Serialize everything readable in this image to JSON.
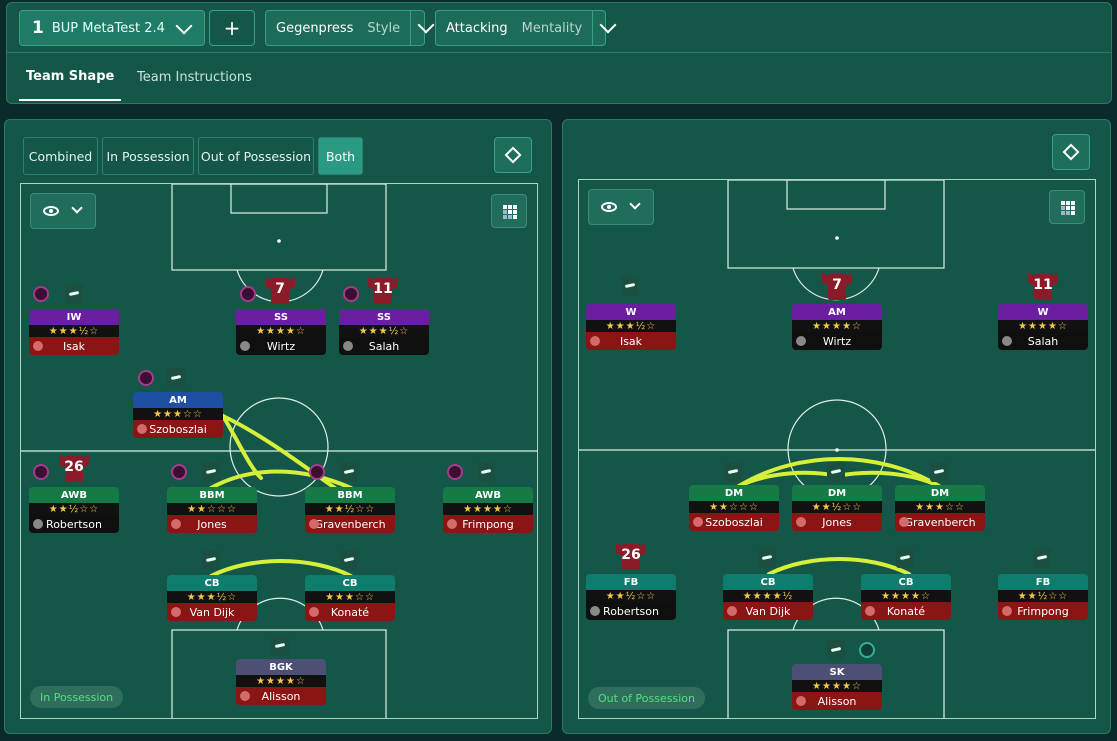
{
  "header": {
    "tactic_number": "1",
    "tactic_name": "BUP MetaTest 2.4",
    "add_label": "+",
    "style_value": "Gegenpress",
    "style_key": "Style",
    "mentality_value": "Attacking",
    "mentality_key": "Mentality"
  },
  "tabs": [
    {
      "label": "Team Shape",
      "active": true
    },
    {
      "label": "Team Instructions",
      "active": false
    }
  ],
  "view_modes": [
    {
      "label": "Combined",
      "selected": false
    },
    {
      "label": "In Possession",
      "selected": false
    },
    {
      "label": "Out of Possession",
      "selected": false
    },
    {
      "label": "Both",
      "selected": true
    }
  ],
  "in_possession": {
    "phase_label": "In Possession",
    "players": [
      {
        "role": "IW",
        "color": "purple",
        "stars": "★★★½☆",
        "name": "Isak",
        "name_style": "bad",
        "shirt": ""
      },
      {
        "role": "SS",
        "color": "purple",
        "stars": "★★★★☆",
        "name": "Wirtz",
        "name_style": "good",
        "shirt": "7"
      },
      {
        "role": "SS",
        "color": "purple",
        "stars": "★★★½☆",
        "name": "Salah",
        "name_style": "good",
        "shirt": "11"
      },
      {
        "role": "AM",
        "color": "blue",
        "stars": "★★★☆☆",
        "name": "Szoboszlai",
        "name_style": "bad",
        "shirt": ""
      },
      {
        "role": "AWB",
        "color": "green",
        "stars": "★★½☆☆",
        "name": "Robertson",
        "name_style": "good",
        "shirt": "26"
      },
      {
        "role": "BBM",
        "color": "green",
        "stars": "★★☆☆☆",
        "name": "Jones",
        "name_style": "bad",
        "shirt": ""
      },
      {
        "role": "BBM",
        "color": "green",
        "stars": "★★½☆☆",
        "name": "Gravenberch",
        "name_style": "bad",
        "shirt": ""
      },
      {
        "role": "AWB",
        "color": "green",
        "stars": "★★★★☆",
        "name": "Frimpong",
        "name_style": "bad",
        "shirt": ""
      },
      {
        "role": "CB",
        "color": "teal",
        "stars": "★★★½☆",
        "name": "Van Dijk",
        "name_style": "bad",
        "shirt": ""
      },
      {
        "role": "CB",
        "color": "teal",
        "stars": "★★★☆☆",
        "name": "Konaté",
        "name_style": "bad",
        "shirt": ""
      },
      {
        "role": "BGK",
        "color": "slate",
        "stars": "★★★★☆",
        "name": "Alisson",
        "name_style": "bad",
        "shirt": ""
      }
    ]
  },
  "out_of_possession": {
    "phase_label": "Out of Possession",
    "players": [
      {
        "role": "W",
        "color": "purple",
        "stars": "★★★½☆",
        "name": "Isak",
        "name_style": "bad",
        "shirt": ""
      },
      {
        "role": "AM",
        "color": "purple",
        "stars": "★★★★☆",
        "name": "Wirtz",
        "name_style": "good",
        "shirt": "7"
      },
      {
        "role": "W",
        "color": "purple",
        "stars": "★★★★☆",
        "name": "Salah",
        "name_style": "good",
        "shirt": "11"
      },
      {
        "role": "DM",
        "color": "green",
        "stars": "★★☆☆☆",
        "name": "Szoboszlai",
        "name_style": "bad",
        "shirt": ""
      },
      {
        "role": "DM",
        "color": "green",
        "stars": "★★½☆☆",
        "name": "Jones",
        "name_style": "bad",
        "shirt": ""
      },
      {
        "role": "DM",
        "color": "green",
        "stars": "★★★☆☆",
        "name": "Gravenberch",
        "name_style": "bad",
        "shirt": ""
      },
      {
        "role": "FB",
        "color": "teal",
        "stars": "★★½☆☆",
        "name": "Robertson",
        "name_style": "good",
        "shirt": "26"
      },
      {
        "role": "CB",
        "color": "teal",
        "stars": "★★★★½",
        "name": "Van Dijk",
        "name_style": "bad",
        "shirt": ""
      },
      {
        "role": "CB",
        "color": "teal",
        "stars": "★★★★☆",
        "name": "Konaté",
        "name_style": "bad",
        "shirt": ""
      },
      {
        "role": "FB",
        "color": "teal",
        "stars": "★★½☆☆",
        "name": "Frimpong",
        "name_style": "bad",
        "shirt": ""
      },
      {
        "role": "SK",
        "color": "slate",
        "stars": "★★★★☆",
        "name": "Alisson",
        "name_style": "bad",
        "shirt": ""
      }
    ]
  },
  "colors": {
    "link_line": "#d6f03a",
    "panel_bg": "#145748",
    "accent": "#2b9a82"
  }
}
